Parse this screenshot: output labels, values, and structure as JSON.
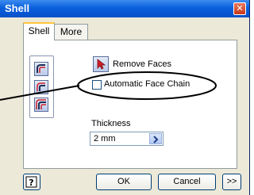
{
  "window": {
    "title": "Shell",
    "close_glyph": "✕"
  },
  "tabs": [
    {
      "label": "Shell"
    },
    {
      "label": "More"
    }
  ],
  "panel": {
    "remove_faces_label": "Remove Faces",
    "automatic_face_chain_label": "Automatic Face Chain",
    "automatic_face_chain_checked": false,
    "thickness_label": "Thickness",
    "thickness_value": "2 mm"
  },
  "buttons": {
    "help": "?",
    "ok": "OK",
    "cancel": "Cancel",
    "more": ">>"
  },
  "icons": {
    "shell_direction_inside": "shell-inside-icon",
    "shell_direction_outside": "shell-outside-icon",
    "shell_direction_both": "shell-both-icon",
    "remove_faces": "select-arrow-icon",
    "thickness_arrow": "chevron-right-icon"
  },
  "colors": {
    "titlebar": "#0a5fdc",
    "dialog_bg": "#ece9d8",
    "callout": "#000000",
    "icon_red": "#d0202a"
  }
}
